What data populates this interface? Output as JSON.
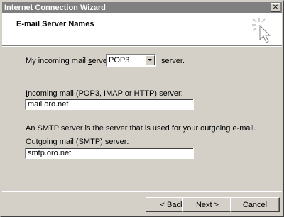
{
  "window": {
    "title": "Internet Connection Wizard",
    "close_glyph": "✕"
  },
  "header": {
    "title": "E-mail Server Names",
    "icon": "wizard-sparkle-cursor-icon"
  },
  "incoming_type": {
    "label_before": "My incoming mail ",
    "label_mnemonic": "s",
    "label_after": "erver is a",
    "selected": "POP3",
    "suffix": "server."
  },
  "incoming_server": {
    "label_mnemonic": "I",
    "label_rest": "ncoming mail (POP3, IMAP or HTTP) server:",
    "value": "mail.oro.net"
  },
  "smtp_info": "An SMTP server is the server that is used for your outgoing e-mail.",
  "outgoing_server": {
    "label_mnemonic": "O",
    "label_rest": "utgoing mail (SMTP) server:",
    "value": "smtp.oro.net"
  },
  "buttons": {
    "back_prefix": "< ",
    "back_mnemonic": "B",
    "back_rest": "ack",
    "next_mnemonic": "N",
    "next_rest": "ext >",
    "cancel": "Cancel"
  },
  "colors": {
    "titlebar_inactive": "#808080",
    "face": "#d4d0c8"
  }
}
